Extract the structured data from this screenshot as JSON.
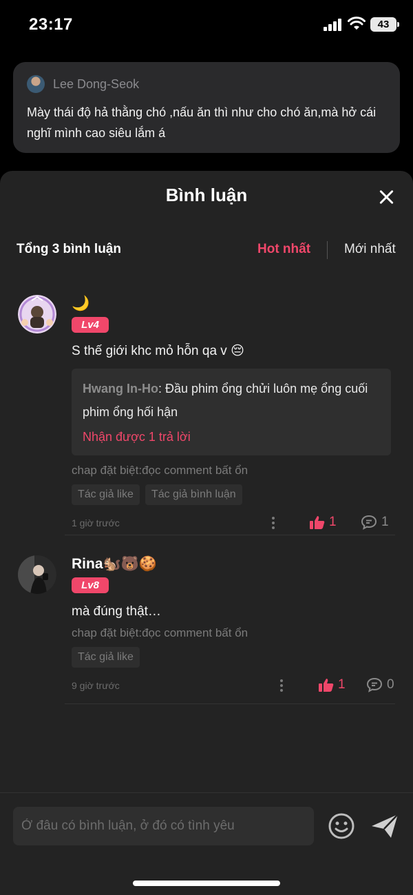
{
  "status_bar": {
    "time": "23:17",
    "battery": "43"
  },
  "quote": {
    "author": "Lee Dong-Seok",
    "text": "Mày thái độ hả thằng chó ,nấu ăn thì như cho chó ăn,mà hở cái nghĩ mình cao siêu lắm á"
  },
  "sheet": {
    "title": "Bình luận",
    "total": "Tổng 3 bình luận",
    "sort_hot": "Hot nhất",
    "sort_new": "Mới nhất"
  },
  "comments": [
    {
      "name": "🌙",
      "level": "Lv4",
      "text": "S thế giới khc mỏ hỗn qa v 😔",
      "reply": {
        "author": "Hwang In-Ho",
        "text": ": Đầu phim ổng chửi luôn mẹ ổng cuối phim ổng hối hận",
        "more": "Nhận được 1 trả lời"
      },
      "chap_note": "chap đặt biệt:đọc comment bất ổn",
      "tags": [
        "Tác giả like",
        "Tác giả bình luận"
      ],
      "time": "1 giờ trước",
      "likes": "1",
      "replies": "1"
    },
    {
      "name": "Rina🐿️🐻🍪",
      "level": "Lv8",
      "text": "mà đúng thật…",
      "chap_note": "chap đặt biệt:đọc comment bất ổn",
      "tags": [
        "Tác giả like"
      ],
      "time": "9 giờ trước",
      "likes": "1",
      "replies": "0"
    }
  ],
  "input": {
    "placeholder": "Ở đâu có bình luận, ở đó có tình yêu"
  },
  "colors": {
    "accent": "#f0476a",
    "sheet_bg": "#232323",
    "card_bg": "#2a2a2c"
  }
}
